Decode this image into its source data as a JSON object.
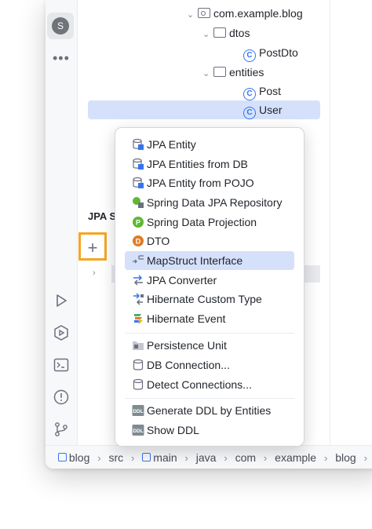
{
  "sidebar": {
    "avatar_letter": "S",
    "more": "•••"
  },
  "tree": {
    "rows": [
      {
        "label": "com.example.blog",
        "kind": "package",
        "expanded": true
      },
      {
        "label": "dtos",
        "kind": "folder",
        "expanded": true
      },
      {
        "label": "PostDto",
        "kind": "class"
      },
      {
        "label": "entities",
        "kind": "folder",
        "expanded": true
      },
      {
        "label": "Post",
        "kind": "class"
      },
      {
        "label": "User",
        "kind": "class",
        "selected": true
      }
    ]
  },
  "jpa_panel": {
    "title": "JPA S",
    "add_button": "+"
  },
  "menu": {
    "groups": [
      [
        {
          "label": "JPA Entity",
          "icon": "jpa-entity-icon"
        },
        {
          "label": "JPA Entities from DB",
          "icon": "jpa-entity-icon"
        },
        {
          "label": "JPA Entity from POJO",
          "icon": "jpa-entity-icon"
        },
        {
          "label": "Spring Data JPA Repository",
          "icon": "spring-repository-icon"
        },
        {
          "label": "Spring Data Projection",
          "icon": "projection-icon",
          "badge": "P"
        },
        {
          "label": "DTO",
          "icon": "dto-icon",
          "badge": "D"
        },
        {
          "label": "MapStruct Interface",
          "icon": "mapstruct-icon",
          "highlighted": true
        },
        {
          "label": "JPA Converter",
          "icon": "converter-icon"
        },
        {
          "label": "Hibernate Custom Type",
          "icon": "custom-type-icon"
        },
        {
          "label": "Hibernate Event",
          "icon": "hibernate-event-icon"
        }
      ],
      [
        {
          "label": "Persistence Unit",
          "icon": "persistence-unit-icon"
        },
        {
          "label": "DB Connection...",
          "icon": "db-connection-icon"
        },
        {
          "label": "Detect Connections...",
          "icon": "detect-connections-icon"
        }
      ],
      [
        {
          "label": "Generate DDL by Entities",
          "icon": "ddl-icon",
          "badge": "DDL"
        },
        {
          "label": "Show DDL",
          "icon": "ddl-icon",
          "badge": "DDL"
        }
      ]
    ]
  },
  "breadcrumbs": [
    "blog",
    "src",
    "main",
    "java",
    "com",
    "example",
    "blog"
  ],
  "colors": {
    "accent": "#3574f0",
    "selection": "#d5e1fb",
    "highlight_box": "#f5a623"
  }
}
